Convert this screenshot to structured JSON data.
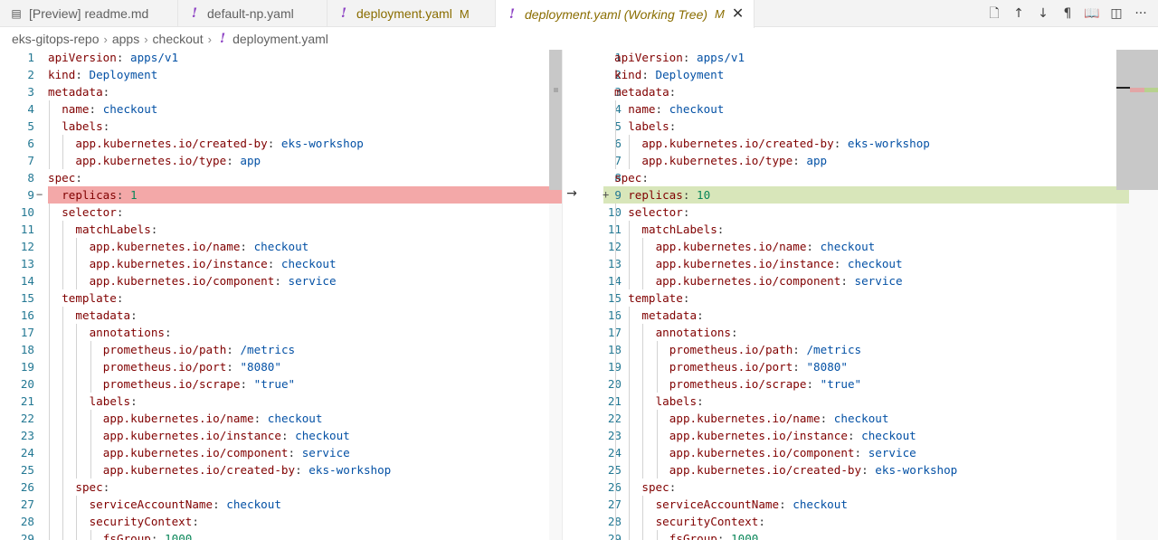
{
  "tabs": [
    {
      "label": "[Preview] readme.md"
    },
    {
      "label": "default-np.yaml"
    },
    {
      "label": "deployment.yaml",
      "badge": "M"
    },
    {
      "label": "deployment.yaml (Working Tree)",
      "badge": "M"
    }
  ],
  "breadcrumb": [
    "eks-gitops-repo",
    "apps",
    "checkout",
    "deployment.yaml"
  ],
  "icons": {
    "preview": "preview-icon",
    "yaml": "exclamation-icon",
    "close": "close-icon",
    "actions": [
      "open-file-icon",
      "arrow-up-icon",
      "arrow-down-icon",
      "pilcrow-icon",
      "book-icon",
      "split-editor-icon",
      "more-icon"
    ]
  },
  "colors": {
    "deleted_line": "#f3a8a8",
    "inserted_line": "#d8e6ba",
    "key": "#800000",
    "value": "#0451a5",
    "number": "#098658",
    "line_number": "#237893"
  },
  "diff": {
    "changed_line": 9,
    "original_marker": "−",
    "modified_marker": "+",
    "arrow": "→"
  },
  "left_editor": {
    "lines": [
      {
        "num": "1",
        "indent": 0,
        "key": "apiVersion",
        "value": "apps/v1"
      },
      {
        "num": "2",
        "indent": 0,
        "key": "kind",
        "value": "Deployment"
      },
      {
        "num": "3",
        "indent": 0,
        "key": "metadata",
        "value": ""
      },
      {
        "num": "4",
        "indent": 1,
        "key": "name",
        "value": "checkout"
      },
      {
        "num": "5",
        "indent": 1,
        "key": "labels",
        "value": ""
      },
      {
        "num": "6",
        "indent": 2,
        "key": "app.kubernetes.io/created-by",
        "value": "eks-workshop"
      },
      {
        "num": "7",
        "indent": 2,
        "key": "app.kubernetes.io/type",
        "value": "app"
      },
      {
        "num": "8",
        "indent": 0,
        "key": "spec",
        "value": ""
      },
      {
        "num": "9",
        "indent": 1,
        "key": "replicas",
        "value": "1",
        "num_value": true
      },
      {
        "num": "10",
        "indent": 1,
        "key": "selector",
        "value": ""
      },
      {
        "num": "11",
        "indent": 2,
        "key": "matchLabels",
        "value": ""
      },
      {
        "num": "12",
        "indent": 3,
        "key": "app.kubernetes.io/name",
        "value": "checkout"
      },
      {
        "num": "13",
        "indent": 3,
        "key": "app.kubernetes.io/instance",
        "value": "checkout"
      },
      {
        "num": "14",
        "indent": 3,
        "key": "app.kubernetes.io/component",
        "value": "service"
      },
      {
        "num": "15",
        "indent": 1,
        "key": "template",
        "value": ""
      },
      {
        "num": "16",
        "indent": 2,
        "key": "metadata",
        "value": ""
      },
      {
        "num": "17",
        "indent": 3,
        "key": "annotations",
        "value": ""
      },
      {
        "num": "18",
        "indent": 4,
        "key": "prometheus.io/path",
        "value": "/metrics"
      },
      {
        "num": "19",
        "indent": 4,
        "key": "prometheus.io/port",
        "value": "\"8080\""
      },
      {
        "num": "20",
        "indent": 4,
        "key": "prometheus.io/scrape",
        "value": "\"true\""
      },
      {
        "num": "21",
        "indent": 3,
        "key": "labels",
        "value": ""
      },
      {
        "num": "22",
        "indent": 4,
        "key": "app.kubernetes.io/name",
        "value": "checkout"
      },
      {
        "num": "23",
        "indent": 4,
        "key": "app.kubernetes.io/instance",
        "value": "checkout"
      },
      {
        "num": "24",
        "indent": 4,
        "key": "app.kubernetes.io/component",
        "value": "service"
      },
      {
        "num": "25",
        "indent": 4,
        "key": "app.kubernetes.io/created-by",
        "value": "eks-workshop"
      },
      {
        "num": "26",
        "indent": 2,
        "key": "spec",
        "value": ""
      },
      {
        "num": "27",
        "indent": 3,
        "key": "serviceAccountName",
        "value": "checkout"
      },
      {
        "num": "28",
        "indent": 3,
        "key": "securityContext",
        "value": ""
      },
      {
        "num": "29",
        "indent": 4,
        "key": "fsGroup",
        "value": "1000",
        "num_value": true
      }
    ]
  },
  "right_editor": {
    "lines": [
      {
        "num": "1",
        "indent": 0,
        "key": "apiVersion",
        "value": "apps/v1"
      },
      {
        "num": "2",
        "indent": 0,
        "key": "kind",
        "value": "Deployment"
      },
      {
        "num": "3",
        "indent": 0,
        "key": "metadata",
        "value": ""
      },
      {
        "num": "4",
        "indent": 1,
        "key": "name",
        "value": "checkout"
      },
      {
        "num": "5",
        "indent": 1,
        "key": "labels",
        "value": ""
      },
      {
        "num": "6",
        "indent": 2,
        "key": "app.kubernetes.io/created-by",
        "value": "eks-workshop"
      },
      {
        "num": "7",
        "indent": 2,
        "key": "app.kubernetes.io/type",
        "value": "app"
      },
      {
        "num": "8",
        "indent": 0,
        "key": "spec",
        "value": ""
      },
      {
        "num": "9",
        "indent": 1,
        "key": "replicas",
        "value": "10",
        "num_value": true
      },
      {
        "num": "10",
        "indent": 1,
        "key": "selector",
        "value": ""
      },
      {
        "num": "11",
        "indent": 2,
        "key": "matchLabels",
        "value": ""
      },
      {
        "num": "12",
        "indent": 3,
        "key": "app.kubernetes.io/name",
        "value": "checkout"
      },
      {
        "num": "13",
        "indent": 3,
        "key": "app.kubernetes.io/instance",
        "value": "checkout"
      },
      {
        "num": "14",
        "indent": 3,
        "key": "app.kubernetes.io/component",
        "value": "service"
      },
      {
        "num": "15",
        "indent": 1,
        "key": "template",
        "value": ""
      },
      {
        "num": "16",
        "indent": 2,
        "key": "metadata",
        "value": ""
      },
      {
        "num": "17",
        "indent": 3,
        "key": "annotations",
        "value": ""
      },
      {
        "num": "18",
        "indent": 4,
        "key": "prometheus.io/path",
        "value": "/metrics"
      },
      {
        "num": "19",
        "indent": 4,
        "key": "prometheus.io/port",
        "value": "\"8080\""
      },
      {
        "num": "20",
        "indent": 4,
        "key": "prometheus.io/scrape",
        "value": "\"true\""
      },
      {
        "num": "21",
        "indent": 3,
        "key": "labels",
        "value": ""
      },
      {
        "num": "22",
        "indent": 4,
        "key": "app.kubernetes.io/name",
        "value": "checkout"
      },
      {
        "num": "23",
        "indent": 4,
        "key": "app.kubernetes.io/instance",
        "value": "checkout"
      },
      {
        "num": "24",
        "indent": 4,
        "key": "app.kubernetes.io/component",
        "value": "service"
      },
      {
        "num": "25",
        "indent": 4,
        "key": "app.kubernetes.io/created-by",
        "value": "eks-workshop"
      },
      {
        "num": "26",
        "indent": 2,
        "key": "spec",
        "value": ""
      },
      {
        "num": "27",
        "indent": 3,
        "key": "serviceAccountName",
        "value": "checkout"
      },
      {
        "num": "28",
        "indent": 3,
        "key": "securityContext",
        "value": ""
      },
      {
        "num": "29",
        "indent": 4,
        "key": "fsGroup",
        "value": "1000",
        "num_value": true
      }
    ]
  }
}
